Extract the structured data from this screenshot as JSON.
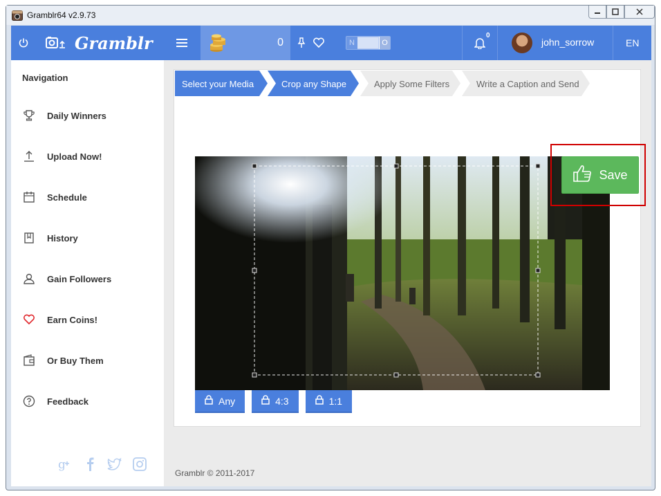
{
  "window": {
    "title": "Gramblr64 v2.9.73"
  },
  "topbar": {
    "brand": "Gramblr",
    "coins": "0",
    "toggle_on": "N",
    "toggle_off": "O",
    "notifications": "0",
    "username": "john_sorrow",
    "language": "EN"
  },
  "sidebar": {
    "heading": "Navigation",
    "items": [
      {
        "label": "Daily Winners",
        "icon": "trophy-icon"
      },
      {
        "label": "Upload Now!",
        "icon": "upload-icon"
      },
      {
        "label": "Schedule",
        "icon": "calendar-icon"
      },
      {
        "label": "History",
        "icon": "book-icon"
      },
      {
        "label": "Gain Followers",
        "icon": "user-icon"
      },
      {
        "label": "Earn Coins!",
        "icon": "heart-icon"
      },
      {
        "label": "Or Buy Them",
        "icon": "wallet-icon"
      },
      {
        "label": "Feedback",
        "icon": "help-icon"
      }
    ]
  },
  "steps": [
    {
      "label": "Select your Media",
      "state": "done"
    },
    {
      "label": "Crop any Shape",
      "state": "active"
    },
    {
      "label": "Apply Some Filters",
      "state": "pending"
    },
    {
      "label": "Write a Caption and Send",
      "state": "pending"
    }
  ],
  "actions": {
    "save_label": "Save"
  },
  "ratios": [
    {
      "label": "Any"
    },
    {
      "label": "4:3"
    },
    {
      "label": "1:1"
    }
  ],
  "footer": {
    "copyright": "Gramblr © 2011-2017"
  },
  "colors": {
    "accent": "#4a7fdd",
    "save": "#5cb85c",
    "highlight": "#d00000"
  }
}
